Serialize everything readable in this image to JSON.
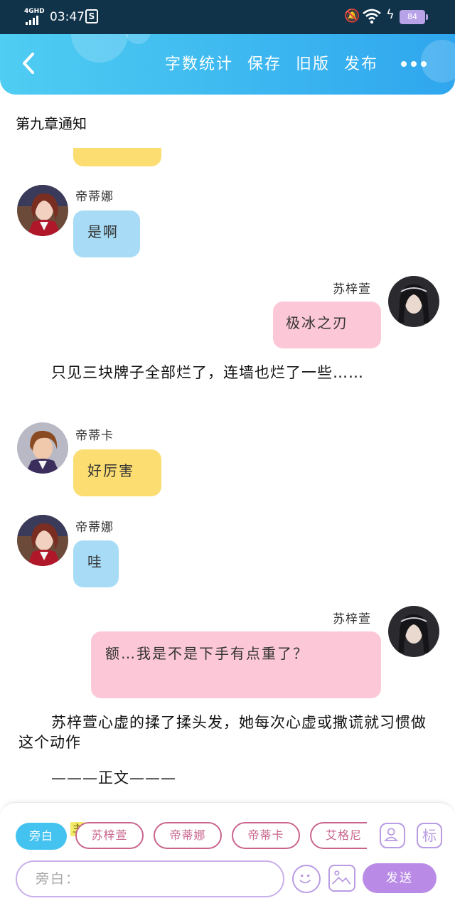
{
  "status_bar": {
    "network": "4GHD",
    "time": "03:47",
    "app_badge": "S",
    "battery": "84",
    "colors": {
      "bar": "#11334a",
      "battery": "#b9a3e8"
    }
  },
  "toolbar": {
    "word_count": "字数统计",
    "save": "保存",
    "old_version": "旧版",
    "publish": "发布",
    "colors": {
      "gradient_start": "#4fcdf2",
      "gradient_end": "#2fa6ee"
    }
  },
  "chapter_title": "第九章通知",
  "messages": [
    {
      "speaker": "帝蒂娜",
      "text": "是啊",
      "side": "left",
      "bubble_color": "#a8dcf6"
    },
    {
      "speaker": "苏梓萱",
      "text": "极冰之刃",
      "side": "right",
      "bubble_color": "#fcc8d7"
    },
    {
      "speaker": "帝蒂卡",
      "text": "好厉害",
      "side": "left",
      "bubble_color": "#fcdd72"
    },
    {
      "speaker": "帝蒂娜",
      "text": "哇",
      "side": "left",
      "bubble_color": "#a8dcf6"
    },
    {
      "speaker": "苏梓萱",
      "text": "额…我是不是下手有点重了？",
      "side": "right",
      "bubble_color": "#fcc8d7"
    }
  ],
  "narrations": [
    "只见三块牌子全部烂了，连墙也烂了一些……",
    "苏梓萱心虚的揉了揉头发，她每次心虚或撒谎就习惯做这个动作",
    "———正文———"
  ],
  "composer": {
    "chips": [
      "旁白",
      "苏梓萱",
      "帝蒂娜",
      "帝蒂卡",
      "艾格尼"
    ],
    "main_badge": "主",
    "tag_icon_label": "标",
    "input_placeholder": "旁白：",
    "send_label": "发送",
    "colors": {
      "active_chip": "#45c3f0",
      "chip_border": "#c9658d",
      "send": "#b98be6"
    }
  }
}
